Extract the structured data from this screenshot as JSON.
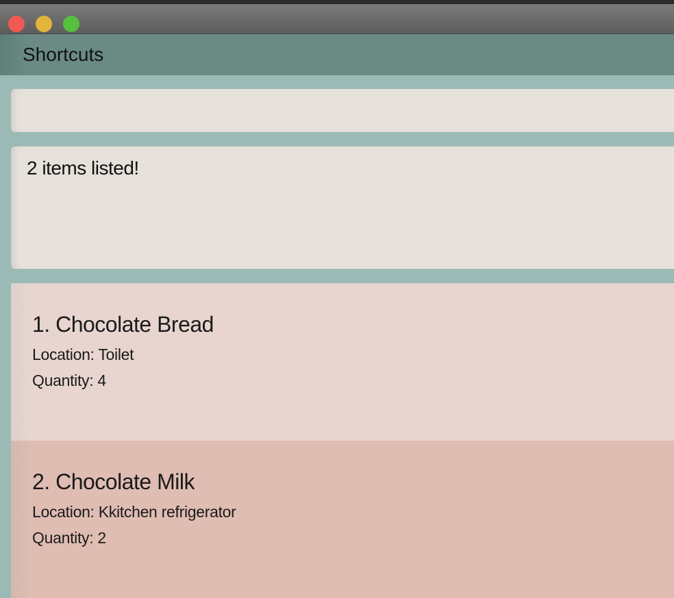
{
  "window": {
    "controls": [
      "close",
      "minimize",
      "maximize"
    ]
  },
  "menu": {
    "items": [
      "Shortcuts"
    ]
  },
  "command": {
    "value": "",
    "placeholder": ""
  },
  "result": {
    "text": "2 items listed!"
  },
  "items": [
    {
      "name": "1. Chocolate Bread",
      "location": "Location: Toilet",
      "quantity": "Quantity: 4"
    },
    {
      "name": "2. Chocolate Milk",
      "location": "Location: Kkitchen refrigerator",
      "quantity": "Quantity: 2"
    }
  ],
  "colors": {
    "background": "#9bbab5",
    "menubar": "#6a8a83",
    "panel": "#e7e1dc",
    "card_odd": "#e8d5d0",
    "card_even": "#dfbdb2"
  }
}
